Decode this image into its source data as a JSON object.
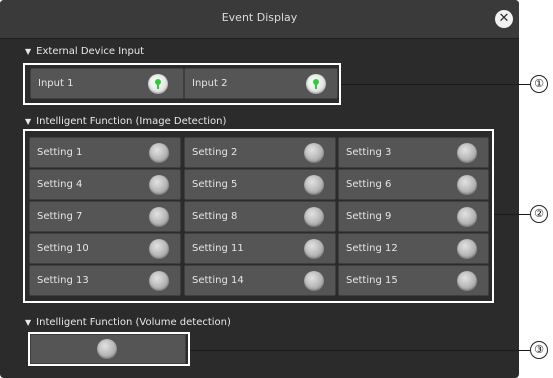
{
  "window": {
    "title": "Event Display",
    "close_symbol": "✕"
  },
  "external": {
    "label": "External Device Input",
    "items": [
      {
        "label": "Input 1",
        "state": "on"
      },
      {
        "label": "Input 2",
        "state": "on"
      }
    ]
  },
  "intelligent": {
    "label": "Intelligent Function (Image Detection)",
    "settings": [
      "Setting 1",
      "Setting 2",
      "Setting 3",
      "Setting 4",
      "Setting 5",
      "Setting 6",
      "Setting 7",
      "Setting 8",
      "Setting 9",
      "Setting 10",
      "Setting 11",
      "Setting 12",
      "Setting 13",
      "Setting 14",
      "Setting 15"
    ]
  },
  "volume": {
    "label": "Intelligent Function (Volume detection)"
  },
  "callouts": [
    "①",
    "②",
    "③"
  ],
  "colors": {
    "panel": "#2b2b2b",
    "cell": "#555555",
    "lamp_on": "#2ecc3a"
  },
  "icons": {
    "section": "triangle-down-icon",
    "close": "close-icon",
    "lamp": "lamp-icon"
  }
}
